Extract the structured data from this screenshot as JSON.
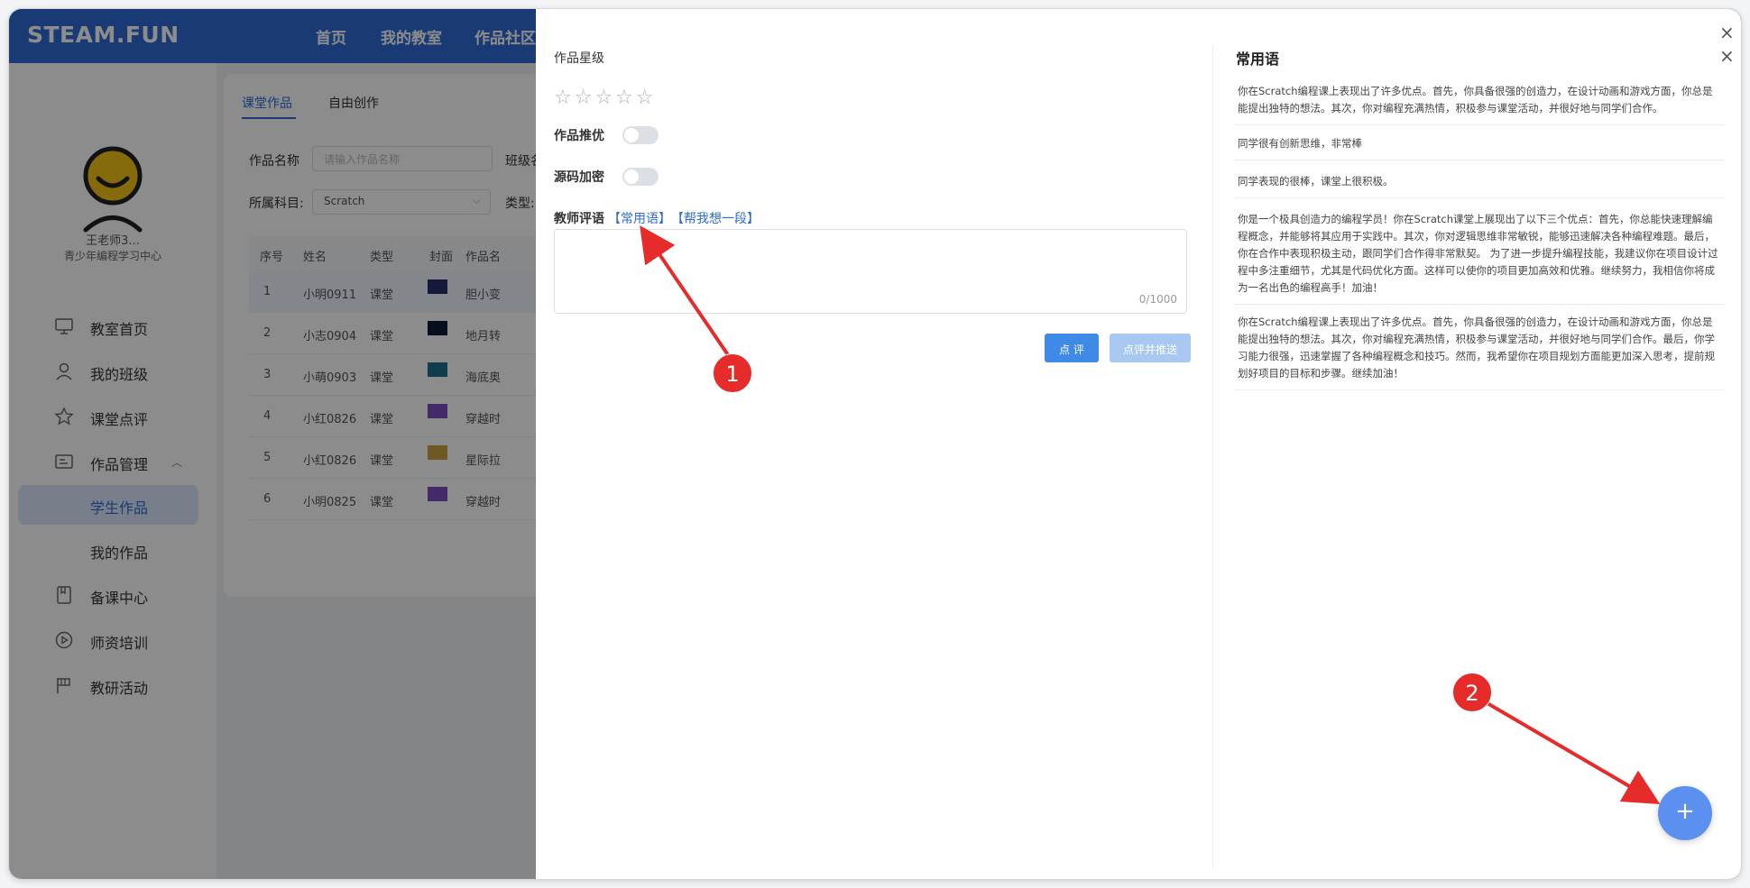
{
  "topnav": {
    "logo": "STEAM.FUN",
    "items": [
      "首页",
      "我的教室",
      "作品社区"
    ]
  },
  "sidebar": {
    "teacher_name": "王老师3...",
    "org": "青少年编程学习中心",
    "menu": [
      {
        "label": "教室首页",
        "icon": "monitor-icon"
      },
      {
        "label": "我的班级",
        "icon": "user-icon"
      },
      {
        "label": "课堂点评",
        "icon": "star-icon"
      },
      {
        "label": "作品管理",
        "icon": "folder-icon"
      },
      {
        "label": "学生作品",
        "icon": ""
      },
      {
        "label": "我的作品",
        "icon": ""
      },
      {
        "label": "备课中心",
        "icon": "book-icon"
      },
      {
        "label": "师资培训",
        "icon": "play-circle-icon"
      },
      {
        "label": "教研活动",
        "icon": "flag-icon"
      }
    ]
  },
  "main": {
    "tabs": [
      "课堂作品",
      "自由创作"
    ],
    "filters": {
      "name_label": "作品名称",
      "name_placeholder": "请输入作品名称",
      "class_label": "班级名",
      "subject_label": "所属科目:",
      "subject_value": "Scratch",
      "type_label": "类型:"
    },
    "table": {
      "headers": [
        "序号",
        "姓名",
        "类型",
        "封面",
        "作品名"
      ],
      "rows": [
        {
          "no": "1",
          "name": "小明0911",
          "type": "课堂",
          "title": "胆小变",
          "cover": "#2a2f6a"
        },
        {
          "no": "2",
          "name": "小志0904",
          "type": "课堂",
          "title": "地月转",
          "cover": "#0d1b3a"
        },
        {
          "no": "3",
          "name": "小萌0903",
          "type": "课堂",
          "title": "海底奥",
          "cover": "#1e6f8f"
        },
        {
          "no": "4",
          "name": "小红0826",
          "type": "课堂",
          "title": "穿越时",
          "cover": "#7a4fc0"
        },
        {
          "no": "5",
          "name": "小红0826",
          "type": "课堂",
          "title": "星际拉",
          "cover": "#c8a040"
        },
        {
          "no": "6",
          "name": "小明0825",
          "type": "课堂",
          "title": "穿越时",
          "cover": "#7a4fc0"
        }
      ]
    }
  },
  "drawer": {
    "rating_label": "作品星级",
    "recommend_label": "作品推优",
    "encrypt_label": "源码加密",
    "comment_label": "教师评语",
    "common_link": "【常用语】",
    "help_link": "【帮我想一段】",
    "counter": "0/1000",
    "comment_button": "点 评",
    "comment_push_button": "点评并推送",
    "phrases_title": "常用语",
    "phrases": [
      "你在Scratch编程课上表现出了许多优点。首先，你具备很强的创造力，在设计动画和游戏方面，你总是能提出独特的想法。其次，你对编程充满热情，积极参与课堂活动，并很好地与同学们合作。",
      "同学很有创新思维，非常棒",
      "同学表现的很棒，课堂上很积极。",
      "你是一个极具创造力的编程学员！你在Scratch课堂上展现出了以下三个优点：首先，你总能快速理解编程概念，并能够将其应用于实践中。其次，你对逻辑思维非常敏锐，能够迅速解决各种编程难题。最后，你在合作中表现积极主动，跟同学们合作得非常默契。 为了进一步提升编程技能，我建议你在项目设计过程中多注重细节，尤其是代码优化方面。这样可以使你的项目更加高效和优雅。继续努力，我相信你将成为一名出色的编程高手！加油！",
      "你在Scratch编程课上表现出了许多优点。首先，你具备很强的创造力，在设计动画和游戏方面，你总是能提出独特的想法。其次，你对编程充满热情，积极参与课堂活动，并很好地与同学们合作。最后，你学习能力很强，迅速掌握了各种编程概念和技巧。然而，我希望你在项目规划方面能更加深入思考，提前规划好项目的目标和步骤。继续加油！"
    ],
    "fab_label": "+"
  },
  "annotations": {
    "badge1": "1",
    "badge2": "2"
  }
}
